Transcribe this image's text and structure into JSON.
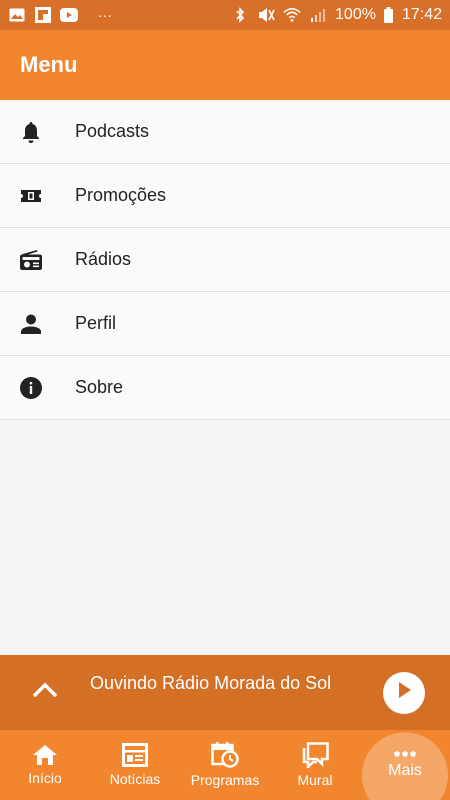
{
  "status_bar": {
    "battery": "100%",
    "time": "17:42",
    "more": "···"
  },
  "header": {
    "title": "Menu"
  },
  "menu": {
    "items": [
      {
        "label": "Podcasts",
        "icon": "bell-icon"
      },
      {
        "label": "Promoções",
        "icon": "ticket-icon"
      },
      {
        "label": "Rádios",
        "icon": "radio-icon"
      },
      {
        "label": "Perfil",
        "icon": "person-icon"
      },
      {
        "label": "Sobre",
        "icon": "info-icon"
      }
    ]
  },
  "player": {
    "now_playing": "Ouvindo Rádio Morada do Sol"
  },
  "bottom_nav": {
    "items": [
      {
        "label": "Início",
        "icon": "home-icon"
      },
      {
        "label": "Notícias",
        "icon": "news-icon"
      },
      {
        "label": "Programas",
        "icon": "calendar-clock-icon"
      },
      {
        "label": "Mural",
        "icon": "chat-icon"
      },
      {
        "label": "Mais",
        "icon": "more-icon",
        "active": true
      }
    ]
  },
  "colors": {
    "primary": "#f2862f",
    "status_bar": "#d9702a",
    "player": "#d46f26"
  }
}
